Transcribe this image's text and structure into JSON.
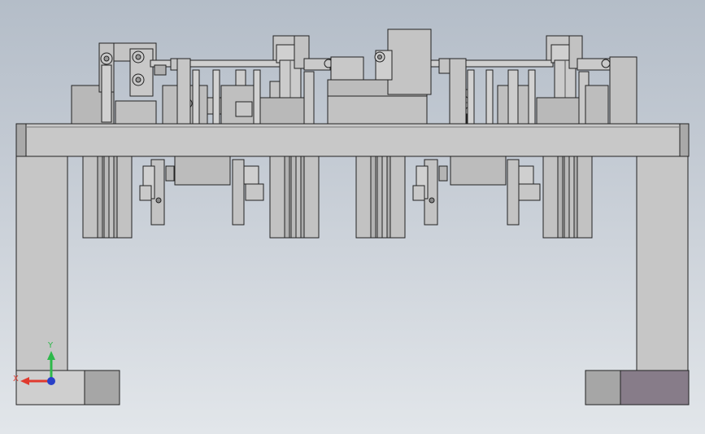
{
  "viewport": {
    "background": "#c7cdd5",
    "view": "front",
    "model": "fixture-assembly"
  },
  "triad": {
    "x_label": "X",
    "y_label": "Y",
    "x_color": "#e03a2e",
    "y_color": "#2db84a",
    "z_color": "#2940c8"
  },
  "colors": {
    "part_light": "#c6c6c6",
    "part_mid": "#b3b3b3",
    "part_dark": "#9a9a9a",
    "edge": "#202020",
    "selected_face": "#877c89"
  }
}
